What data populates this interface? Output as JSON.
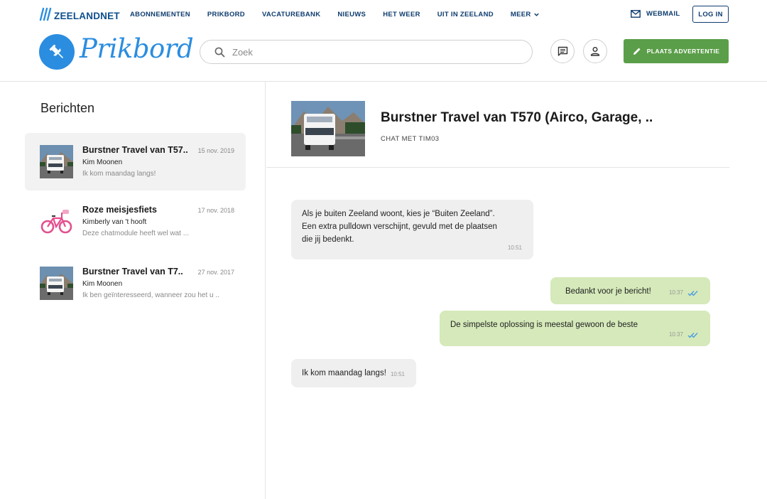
{
  "topnav": {
    "brand": "ZEELANDNET",
    "links": [
      "ABONNEMENTEN",
      "PRIKBORD",
      "VACATUREBANK",
      "NIEUWS",
      "HET WEER",
      "UIT IN ZEELAND",
      "MEER"
    ],
    "webmail": "WEBMAIL",
    "login": "LOG IN"
  },
  "header": {
    "title": "Prikbord",
    "search_placeholder": "Zoek",
    "place_ad": "PLAATS ADVERTENTIE"
  },
  "sidebar": {
    "title": "Berichten",
    "conversations": [
      {
        "title": "Burstner Travel van T57..",
        "date": "15 nov. 2019",
        "user": "Kim Moonen",
        "preview": "Ik kom maandag langs!",
        "thumb": "camper-icon",
        "active": true
      },
      {
        "title": "Roze meisjesfiets",
        "date": "17 nov. 2018",
        "user": "Kimberly van 't hooft",
        "preview": "Deze chatmodule heeft wel wat ...",
        "thumb": "bicycle-icon",
        "active": false
      },
      {
        "title": "Burstner Travel van T7..",
        "date": "27 nov. 2017",
        "user": "Kim Moonen",
        "preview": "Ik ben geïnteresseerd, wanneer zou het u ..",
        "thumb": "camper-icon",
        "active": false
      }
    ]
  },
  "chat": {
    "title": "Burstner Travel van T570 (Airco, Garage, ..",
    "subtitle": "CHAT MET TIM03",
    "messages": [
      {
        "direction": "in",
        "lines": [
          "Als je buiten Zeeland woont, kies je “Buiten Zeeland”.",
          "Een extra pulldown verschijnt, gevuld met de plaatsen",
          "die jij bedenkt."
        ],
        "time": "10:51"
      },
      {
        "direction": "out",
        "lines": [
          "Bedankt voor je bericht!"
        ],
        "time": "10:37"
      },
      {
        "direction": "out",
        "lines": [
          "De simpelste oplossing is meestal gewoon de beste"
        ],
        "time": "10:37"
      },
      {
        "direction": "in",
        "lines": [
          "Ik kom maandag langs!"
        ],
        "time": "10:51"
      }
    ]
  },
  "colors": {
    "brand_blue": "#2b8de0",
    "nav_navy": "#0e3c6e",
    "accent_green": "#5b9e49",
    "outgoing_bubble": "#d5e9ba",
    "incoming_bubble": "#efefef",
    "read_check": "#4a9be0"
  }
}
